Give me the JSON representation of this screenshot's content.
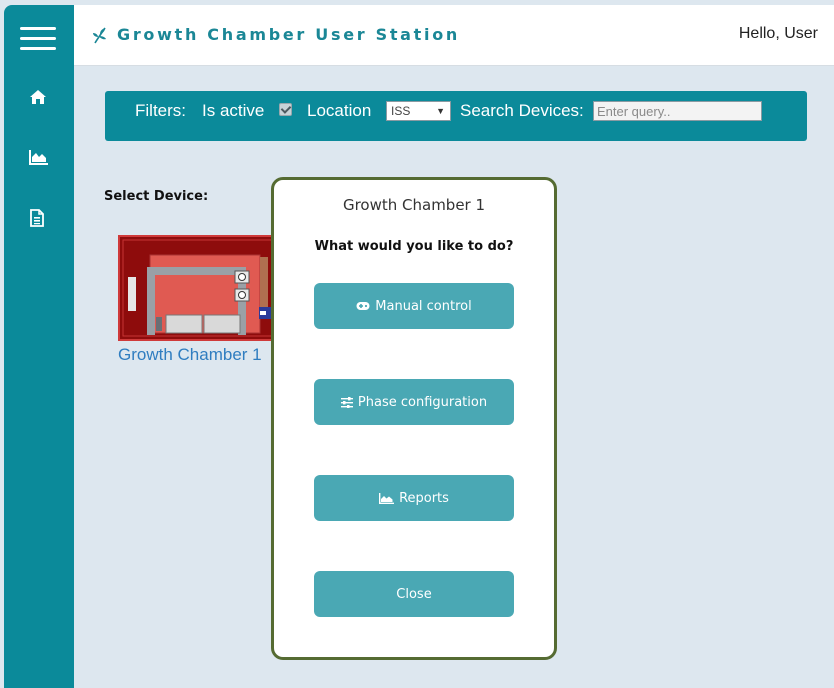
{
  "header": {
    "title": "Growth Chamber User Station",
    "greeting": "Hello, User",
    "logo_icon": "leaf-icon"
  },
  "sidebar": {
    "items": [
      {
        "icon": "home-icon"
      },
      {
        "icon": "area-chart-icon"
      },
      {
        "icon": "document-icon"
      }
    ]
  },
  "filters": {
    "label": "Filters:",
    "is_active_label": "Is active",
    "is_active_checked": true,
    "location_label": "Location",
    "location_value": "ISS",
    "search_label": "Search Devices:",
    "search_placeholder": "Enter query.."
  },
  "main": {
    "select_device_label": "Select Device:",
    "devices": [
      {
        "name": "Growth Chamber 1"
      }
    ]
  },
  "modal": {
    "title": "Growth Chamber 1",
    "question": "What would you like to do?",
    "buttons": [
      {
        "label": "Manual control",
        "icon": "gamepad-icon"
      },
      {
        "label": "Phase configuration",
        "icon": "sliders-icon"
      },
      {
        "label": "Reports",
        "icon": "area-chart-icon"
      },
      {
        "label": "Close"
      }
    ]
  },
  "colors": {
    "teal": "#0b8a9a",
    "button": "#4aa8b4",
    "modal_border": "#556b32",
    "link": "#2f7dc0"
  }
}
